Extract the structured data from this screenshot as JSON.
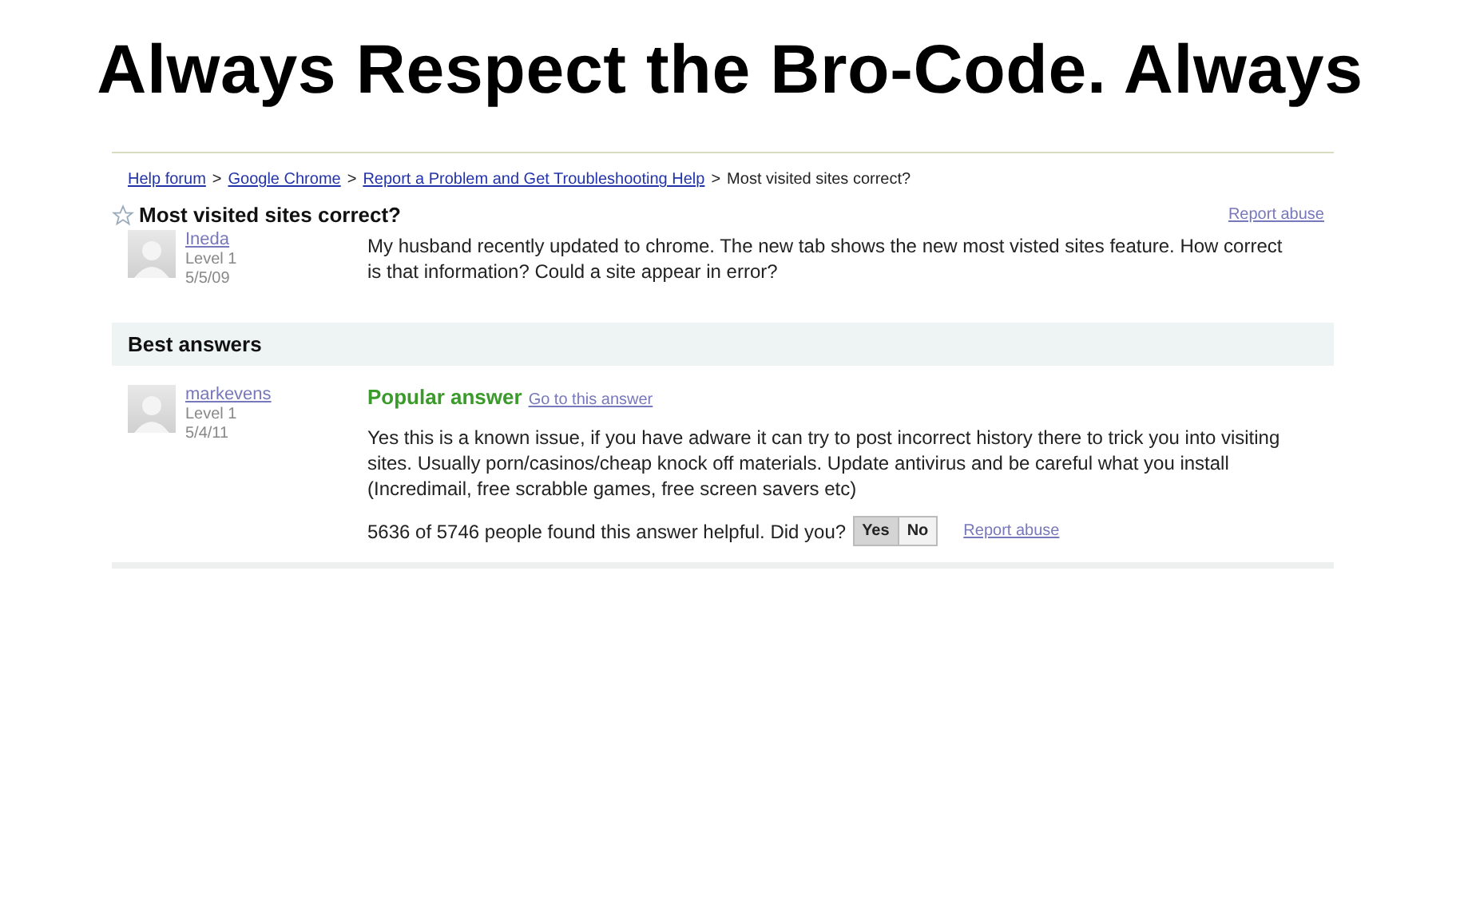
{
  "headline": "Always Respect the Bro-Code. Always",
  "breadcrumb": {
    "separator": ">",
    "items": [
      {
        "label": "Help forum",
        "kind": "link"
      },
      {
        "label": "Google Chrome",
        "kind": "link"
      },
      {
        "label": "Report a Problem and Get Troubleshooting Help",
        "kind": "link"
      },
      {
        "label": "Most visited sites correct?",
        "kind": "current"
      }
    ]
  },
  "question": {
    "title": "Most visited sites correct?",
    "starred": false,
    "report_link": "Report abuse",
    "author": {
      "name": "Ineda",
      "level": "Level 1",
      "date": "5/5/09"
    },
    "body": "My  husband recently updated to chrome.  The new tab shows the new most visted sites feature.  How correct is that information? Could a site appear in error?"
  },
  "best_answers": {
    "heading": "Best answers",
    "answer": {
      "author": {
        "name": "markevens",
        "level": "Level 1",
        "date": "5/4/11"
      },
      "label": "Popular answer",
      "goto_link": "Go to this answer",
      "body": "Yes this is a known issue, if you have adware it can try to post incorrect history there to trick you into visiting sites. Usually porn/casinos/cheap knock off materials. Update antivirus and be careful what you install (Incredimail, free scrabble games, free screen savers etc)",
      "helpful": "5636 of 5746 people found this answer helpful. Did you?",
      "votes": [
        {
          "label": "Yes",
          "selected": true
        },
        {
          "label": "No",
          "selected": false
        }
      ],
      "report_link": "Report abuse"
    }
  }
}
